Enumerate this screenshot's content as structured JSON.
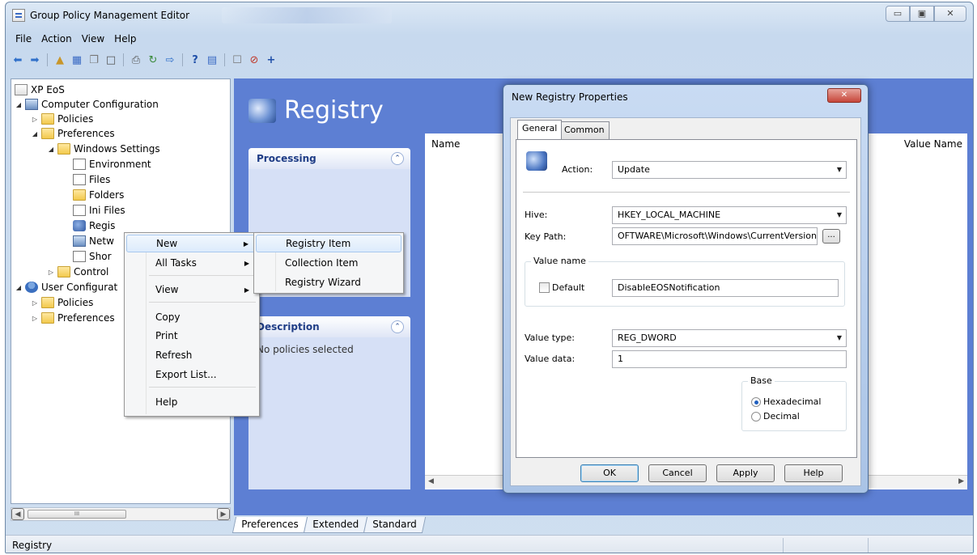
{
  "window": {
    "title": "Group Policy Management Editor",
    "controls": [
      "▭",
      "▣",
      "✕"
    ]
  },
  "menu": [
    "File",
    "Action",
    "View",
    "Help"
  ],
  "toolbar_icons": [
    "back-icon",
    "forward-icon",
    "up-icon",
    "show-hide-tree-icon",
    "copy-icon",
    "paste-icon",
    "print-icon",
    "refresh-icon",
    "export-icon",
    "help-icon",
    "properties-icon",
    "preview-icon",
    "stop-icon",
    "add-icon"
  ],
  "tree": {
    "root": "XP EoS",
    "computer_configuration": "Computer Configuration",
    "policies": "Policies",
    "preferences": "Preferences",
    "windows_settings": "Windows Settings",
    "environment": "Environment",
    "files": "Files",
    "folders": "Folders",
    "ini_files": "Ini Files",
    "registry": "Regis",
    "network": "Netw",
    "shortcuts": "Shor",
    "control_panel": "Control",
    "user_configuration": "User Configurat",
    "user_policies": "Policies",
    "user_preferences": "Preferences"
  },
  "tree_scrollbar": {
    "thumb_label": "III"
  },
  "right_pane": {
    "heading": "Registry",
    "processing_title": "Processing",
    "description_title": "Description",
    "description_text": "No policies selected",
    "col_name": "Name",
    "col_value_name": "Value Name"
  },
  "bottom_tabs": [
    "Preferences",
    "Extended",
    "Standard"
  ],
  "status": {
    "text": "Registry"
  },
  "context_menu": {
    "items": [
      "New",
      "All Tasks",
      "View",
      "Copy",
      "Print",
      "Refresh",
      "Export List...",
      "Help"
    ]
  },
  "submenu": {
    "items": [
      "Registry Item",
      "Collection Item",
      "Registry Wizard"
    ]
  },
  "dialog": {
    "title": "New Registry Properties",
    "close_glyph": "✕",
    "tabs": [
      "General",
      "Common"
    ],
    "action_label": "Action:",
    "action_value": "Update",
    "hive_label": "Hive:",
    "hive_value": "HKEY_LOCAL_MACHINE",
    "keypath_label": "Key Path:",
    "keypath_value": "OFTWARE\\Microsoft\\Windows\\CurrentVersion",
    "browse_label": "...",
    "value_name_group": "Value name",
    "default_label": "Default",
    "value_name_value": "DisableEOSNotification",
    "value_type_label": "Value type:",
    "value_type_value": "REG_DWORD",
    "value_data_label": "Value data:",
    "value_data_value": "1",
    "base_group": "Base",
    "hex_label": "Hexadecimal",
    "dec_label": "Decimal",
    "buttons": {
      "ok": "OK",
      "cancel": "Cancel",
      "apply": "Apply",
      "help": "Help"
    }
  }
}
